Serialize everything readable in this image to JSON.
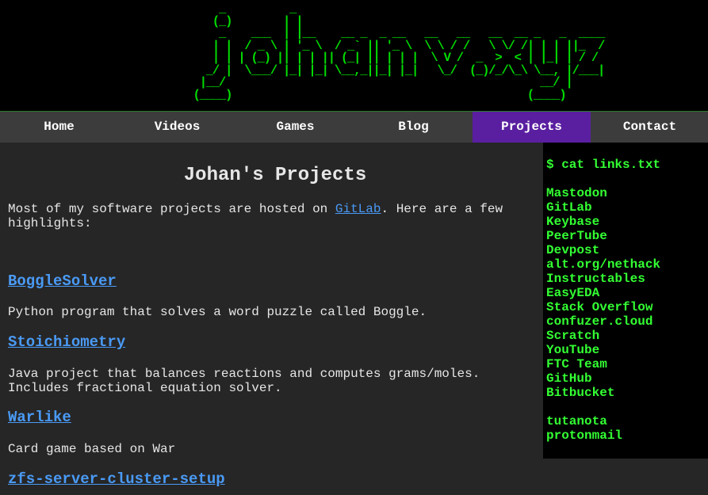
{
  "banner": {
    "ascii_art": "          _          _\n         (_)        | |\n          _    ___  | |__    __ _  _ __   __   __   __  __ _   _  ____\n         | |  / _ \\ | '_ \\  / _` || '_ \\  \\ \\ / /   \\ \\/ /| | | ||_  /\n         | | | (_) || | | || (_| || | | |  \\ V /  _  >  < | |_| | / /\n        _/ |  \\___/ |_| |_| \\__,_||_| |_|   \\_/  (_)/_/\\_\\ \\__, |/___|\n       |__/                                                 __/ |\n      (____)                                              (____)"
  },
  "nav": {
    "items": [
      {
        "label": "Home"
      },
      {
        "label": "Videos"
      },
      {
        "label": "Games"
      },
      {
        "label": "Blog"
      },
      {
        "label": "Projects"
      },
      {
        "label": "Contact"
      }
    ],
    "active_color": "#5a1fa0"
  },
  "main": {
    "title": "Johan's Projects",
    "intro_before": "Most of my software projects are hosted on ",
    "intro_link": "GitLab",
    "intro_after": ". Here are a few highlights:",
    "projects": [
      {
        "name": "BoggleSolver",
        "description": "Python program that solves a word puzzle called Boggle."
      },
      {
        "name": "Stoichiometry",
        "description": "Java project that balances reactions and computes grams/moles. Includes fractional equation solver."
      },
      {
        "name": "Warlike",
        "description": "Card game based on War"
      },
      {
        "name": "zfs-server-cluster-setup",
        "description": ""
      }
    ]
  },
  "sidebar": {
    "command": "$ cat links.txt",
    "links": [
      "Mastodon",
      "GitLab",
      "Keybase",
      "PeerTube",
      "Devpost",
      "alt.org/nethack",
      "Instructables",
      "EasyEDA",
      "Stack Overflow",
      "confuzer.cloud",
      "Scratch",
      "YouTube",
      "FTC Team",
      "GitHub",
      "Bitbucket"
    ],
    "email_links": [
      "tutanota",
      "protonmail"
    ]
  },
  "colors": {
    "terminal_green": "#33ff33",
    "link_blue": "#4a9af5",
    "background": "#262626"
  }
}
